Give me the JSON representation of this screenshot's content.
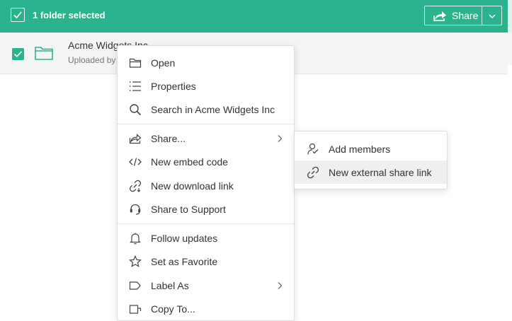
{
  "colors": {
    "accent": "#2bb38e",
    "row_bg": "#f3f4f4",
    "hover_bg": "#efefef"
  },
  "topbar": {
    "selection_label": "1 folder selected",
    "share_label": "Share"
  },
  "row": {
    "name": "Acme Widgets Inc",
    "subtitle": "Uploaded by"
  },
  "menu": {
    "items": [
      {
        "label": "Open",
        "icon": "folder-open-icon"
      },
      {
        "label": "Properties",
        "icon": "list-icon"
      },
      {
        "label": "Search in Acme Widgets Inc",
        "icon": "search-icon"
      },
      {
        "label": "Share...",
        "icon": "share-icon",
        "has_submenu": true
      },
      {
        "label": "New embed code",
        "icon": "code-icon"
      },
      {
        "label": "New download link",
        "icon": "download-link-icon"
      },
      {
        "label": "Share to Support",
        "icon": "headset-icon"
      },
      {
        "label": "Follow updates",
        "icon": "bell-icon"
      },
      {
        "label": "Set as Favorite",
        "icon": "star-icon"
      },
      {
        "label": "Label As",
        "icon": "label-icon",
        "has_submenu": true
      },
      {
        "label": "Copy To...",
        "icon": "copy-icon"
      }
    ]
  },
  "submenu": {
    "items": [
      {
        "label": "Add members",
        "icon": "add-member-icon"
      },
      {
        "label": "New external share link",
        "icon": "link-icon",
        "highlighted": true
      }
    ]
  }
}
